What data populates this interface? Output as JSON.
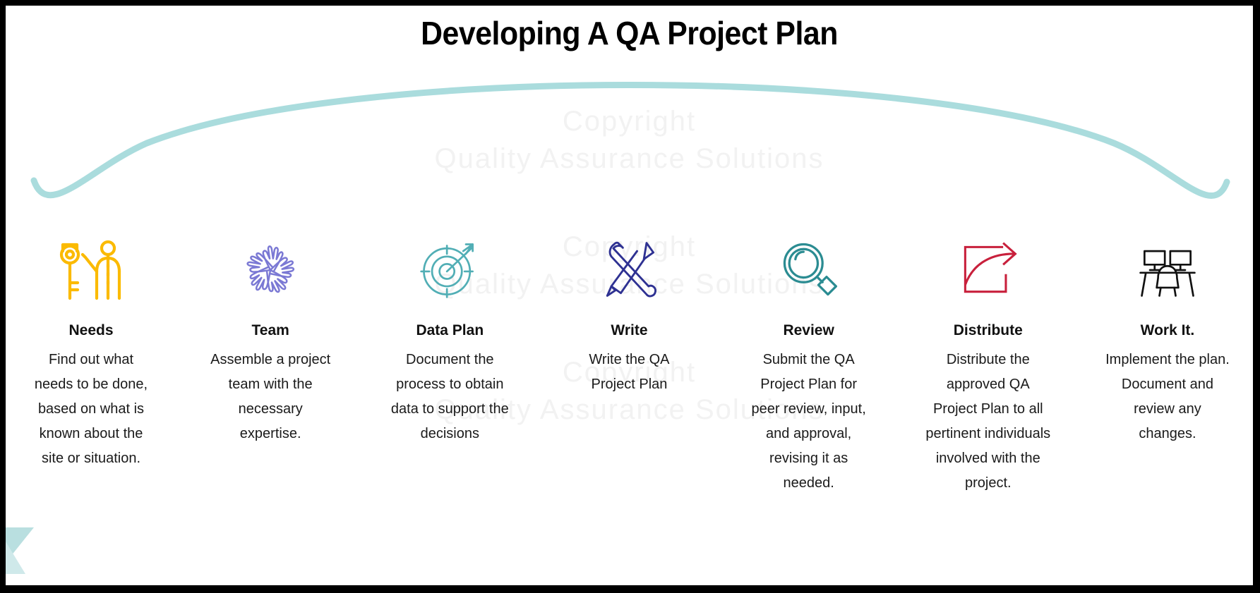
{
  "slide": {
    "title": "Developing A QA Project Plan",
    "background_color": "#ffffff",
    "border_color": "#000000",
    "accent_arc_color": "#aadcdd"
  },
  "watermark": {
    "line1": "Copyright",
    "line2": "Quality Assurance Solutions",
    "line3": "Copyright",
    "line4": "Quality Assurance Solutions",
    "line5": "Copyright",
    "line6": "Quality Assurance Solutions",
    "color": "#f2f2f2"
  },
  "steps": [
    {
      "icon": "key-and-person-icon",
      "icon_color": "#fbba00",
      "title": "Needs",
      "body": "Find out what needs to be done, based on what is known about the site or situation."
    },
    {
      "icon": "teamwork-hands-icon",
      "icon_color": "#7b79d4",
      "title": "Team",
      "body": "Assemble a project team with the necessary expertise."
    },
    {
      "icon": "target-arrow-icon",
      "icon_color": "#51aeb5",
      "title": "Data Plan",
      "body": "Document the process to obtain data to support the decisions"
    },
    {
      "icon": "wrench-and-pencil-icon",
      "icon_color": "#2e3192",
      "title": "Write",
      "body": "Write the QA Project Plan"
    },
    {
      "icon": "magnifying-glass-icon",
      "icon_color": "#2b8c92",
      "title": "Review",
      "body": "Submit the QA Project Plan for peer review, input, and approval, revising it as needed."
    },
    {
      "icon": "share-export-arrow-icon",
      "icon_color": "#c8203c",
      "title": "Distribute",
      "body": "Distribute the approved QA Project Plan to all pertinent individuals involved with the project."
    },
    {
      "icon": "workstation-desk-icon",
      "icon_color": "#000000",
      "title": "Work It.",
      "body": "Implement the plan. Document and review any changes."
    }
  ]
}
